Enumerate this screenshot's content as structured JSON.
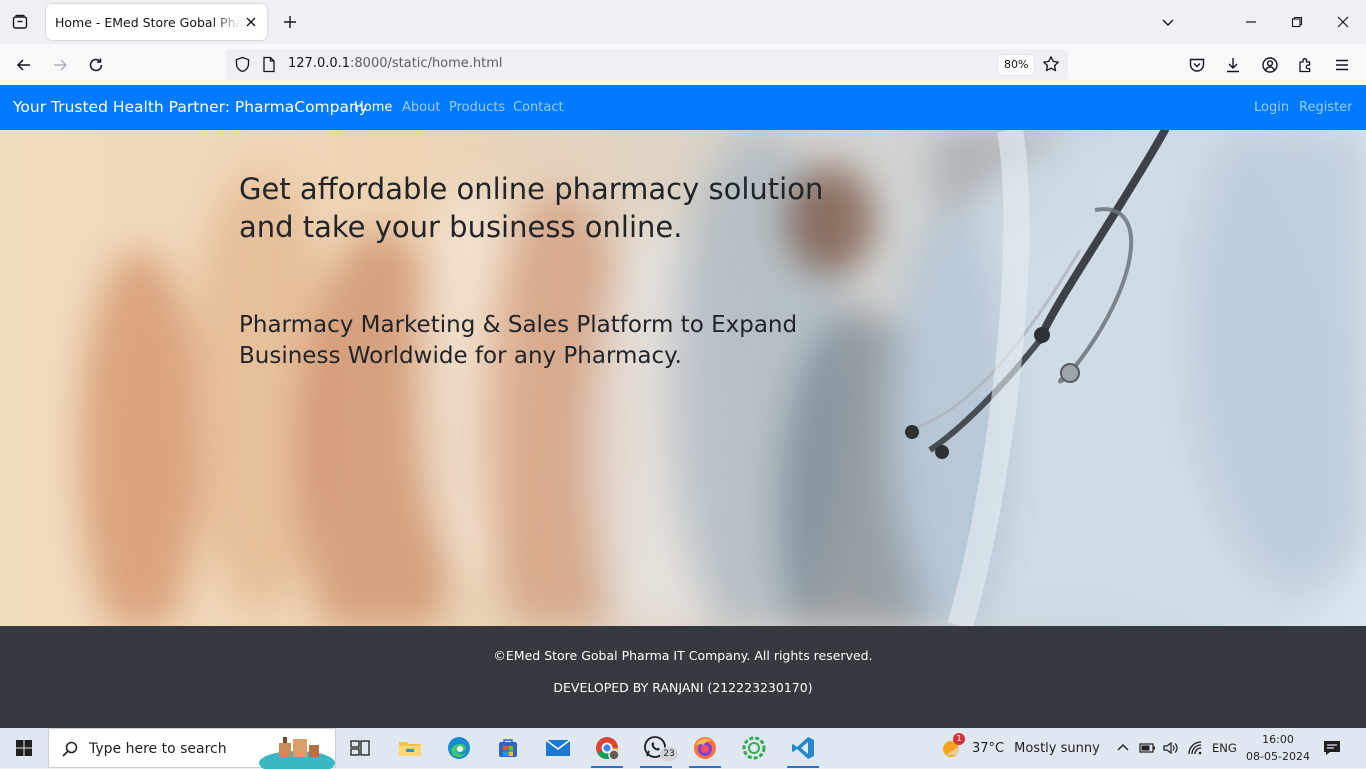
{
  "browser": {
    "tab": {
      "title": "Home - EMed Store Gobal Pharma IT Company"
    },
    "url": {
      "host": "127.0.0.1",
      "rest": ":8000/static/home.html"
    },
    "zoom": "80%"
  },
  "site": {
    "brand": "Your Trusted Health Partner: PharmaCompany",
    "nav": {
      "home": "Home",
      "about": "About",
      "products": "Products",
      "contact": "Contact",
      "login": "Login",
      "register": "Register"
    },
    "hero": {
      "title": "Get affordable online pharmacy solution and take your business online.",
      "subtitle": "Pharmacy Marketing & Sales Platform to Expand Business Worldwide for any Pharmacy."
    },
    "footer": {
      "copyright": "©EMed Store Gobal Pharma IT Company. All rights reserved.",
      "developer": "DEVELOPED BY RANJANI (212223230170)"
    }
  },
  "taskbar": {
    "search_placeholder": "Type here to search",
    "whatsapp_badge": "23",
    "weather": {
      "alert": "1",
      "temp": "37°C",
      "condition": "Mostly sunny"
    },
    "lang": "ENG",
    "time": "16:00",
    "date": "08-05-2024"
  },
  "colors": {
    "primary": "#007bff",
    "footer": "#343a40",
    "taskbar": "#dfe7f1"
  }
}
